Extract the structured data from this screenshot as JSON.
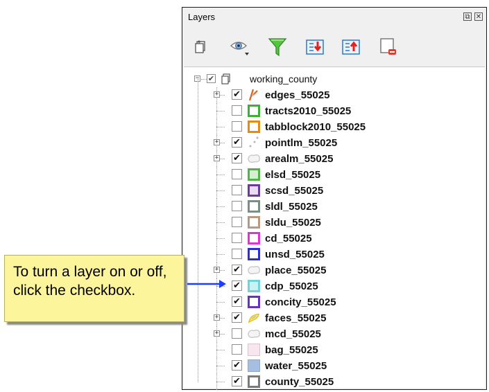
{
  "panel": {
    "title": "Layers",
    "float_glyph": "⧉",
    "close_glyph": "✕",
    "toolbar": [
      {
        "name": "add-group-icon"
      },
      {
        "name": "visibility-eye-icon"
      },
      {
        "name": "filter-funnel-icon"
      },
      {
        "name": "expand-all-icon"
      },
      {
        "name": "collapse-all-icon"
      },
      {
        "name": "remove-layer-icon"
      }
    ]
  },
  "tree": {
    "root": {
      "label": "working_county",
      "checked": true
    },
    "layers": [
      {
        "label": "edges_55025",
        "checked": true,
        "expandable": true,
        "symbol": "line-edges",
        "color": "#d9641d"
      },
      {
        "label": "tracts2010_55025",
        "checked": false,
        "expandable": false,
        "symbol": "box",
        "color": "#3bb13a",
        "fill": "#ffffff"
      },
      {
        "label": "tabblock2010_55025",
        "checked": false,
        "expandable": false,
        "symbol": "box",
        "color": "#e58a12",
        "fill": "#ffffff"
      },
      {
        "label": "pointlm_55025",
        "checked": true,
        "expandable": true,
        "symbol": "points",
        "color": "#b5b5b5"
      },
      {
        "label": "arealm_55025",
        "checked": true,
        "expandable": true,
        "symbol": "blob",
        "color": "#c8c8c8"
      },
      {
        "label": "elsd_55025",
        "checked": false,
        "expandable": false,
        "symbol": "box",
        "color": "#4fb548",
        "fill": "#d5efd3"
      },
      {
        "label": "scsd_55025",
        "checked": false,
        "expandable": false,
        "symbol": "box",
        "color": "#6c3a9a",
        "fill": "#eadcf4"
      },
      {
        "label": "sldl_55025",
        "checked": false,
        "expandable": false,
        "symbol": "box",
        "color": "#7a8f84",
        "fill": "#ffffff"
      },
      {
        "label": "sldu_55025",
        "checked": false,
        "expandable": false,
        "symbol": "box",
        "color": "#b89a80",
        "fill": "#ffffff"
      },
      {
        "label": "cd_55025",
        "checked": false,
        "expandable": false,
        "symbol": "box",
        "color": "#e62fd6",
        "fill": "#ffffff"
      },
      {
        "label": "unsd_55025",
        "checked": false,
        "expandable": false,
        "symbol": "box",
        "color": "#2d2fd6",
        "fill": "#ffffff"
      },
      {
        "label": "place_55025",
        "checked": true,
        "expandable": true,
        "symbol": "blob",
        "color": "#c8c8c8"
      },
      {
        "label": "cdp_55025",
        "checked": true,
        "expandable": false,
        "symbol": "box",
        "color": "#6fd3d8",
        "fill": "#c9f1f3"
      },
      {
        "label": "concity_55025",
        "checked": true,
        "expandable": false,
        "symbol": "box",
        "color": "#6a2fc4",
        "fill": "#ffffff"
      },
      {
        "label": "faces_55025",
        "checked": true,
        "expandable": true,
        "symbol": "faces",
        "color": "#e3c320"
      },
      {
        "label": "mcd_55025",
        "checked": false,
        "expandable": true,
        "symbol": "blob",
        "color": "#c8c8c8"
      },
      {
        "label": "bag_55025",
        "checked": false,
        "expandable": false,
        "symbol": "solid",
        "color": "#d8c2cc",
        "fill": "#f7e6ee"
      },
      {
        "label": "water_55025",
        "checked": true,
        "expandable": false,
        "symbol": "solid",
        "color": "#8aa8d0",
        "fill": "#a6bee0"
      },
      {
        "label": "county_55025",
        "checked": true,
        "expandable": false,
        "symbol": "box",
        "color": "#7a7a7a",
        "fill": "#ffffff"
      }
    ]
  },
  "callout": {
    "text": "To turn a layer on or off, click the checkbox.",
    "arrow_color": "#1f3cff"
  }
}
